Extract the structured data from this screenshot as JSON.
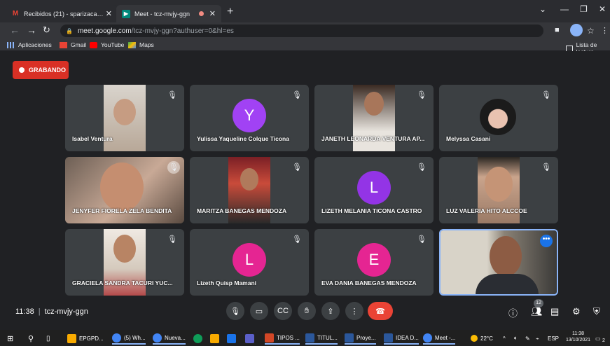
{
  "browser": {
    "tabs": [
      {
        "title": "Recibidos (21) - sparizaca@epg...",
        "favicon": "gmail-icon"
      },
      {
        "title": "Meet - tcz-mvjy-ggn",
        "favicon": "meet-icon",
        "recording": true
      }
    ],
    "new_tab": "+",
    "url_host": "meet.google.com",
    "url_path": "/tcz-mvjy-ggn?authuser=0&hl=es",
    "bookmarks": [
      "Aplicaciones",
      "Gmail",
      "YouTube",
      "Maps"
    ],
    "reading_list": "Lista de lectura"
  },
  "meet": {
    "recording_label": "GRABANDO",
    "meeting_time": "11:38",
    "meeting_code": "tcz-mvjy-ggn",
    "participants_count": "12",
    "participants": [
      {
        "name": "Isabel Ventura",
        "type": "video"
      },
      {
        "name": "Yulissa Yaqueline Colque Ticona",
        "type": "avatar",
        "initial": "Y",
        "color": "#a142f4"
      },
      {
        "name": "JANETH LEONARDA VENTURA AP...",
        "type": "video"
      },
      {
        "name": "Melyssa Casani",
        "type": "video"
      },
      {
        "name": "JENYFER FIORELA ZELA BENDITA",
        "type": "video"
      },
      {
        "name": "MARITZA BANEGAS MENDOZA",
        "type": "video"
      },
      {
        "name": "LIZETH MELANIA TICONA CASTRO",
        "type": "avatar",
        "initial": "L",
        "color": "#9334e6"
      },
      {
        "name": "LUZ VALERIA HITO ALCCOE",
        "type": "video"
      },
      {
        "name": "GRACIELA SANDRA TACURI YUC...",
        "type": "video"
      },
      {
        "name": "Lizeth Quisp Mamani",
        "type": "avatar",
        "initial": "L",
        "color": "#e52592"
      },
      {
        "name": "EVA DANIA BANEGAS MENDOZA",
        "type": "avatar",
        "initial": "E",
        "color": "#e52592"
      },
      {
        "name": "",
        "type": "video",
        "self": true
      }
    ]
  },
  "taskbar": {
    "apps": [
      "EPGPD...",
      "(5) Wh...",
      "Nueva...",
      "TIPOS ...",
      "TITUL...",
      "Proye...",
      "IDEA D...",
      "Meet -..."
    ],
    "weather": "22°C",
    "language": "ESP",
    "time": "11:38",
    "date": "13/10/2021",
    "notification_count": "2"
  }
}
